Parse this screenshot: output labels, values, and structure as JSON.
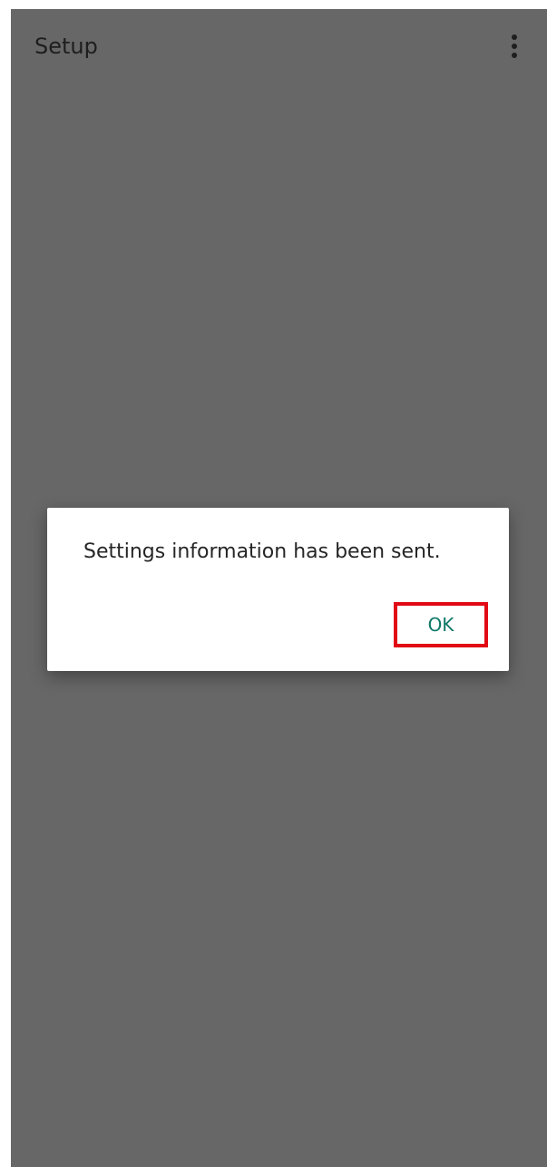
{
  "app_bar": {
    "title": "Setup",
    "menu_icon": "more-vert-icon"
  },
  "dialog": {
    "message": "Settings information has been sent.",
    "ok_label": "OK"
  },
  "colors": {
    "scrim": "#666766",
    "ok_text": "#0f7868",
    "highlight_border": "#e10a14"
  }
}
